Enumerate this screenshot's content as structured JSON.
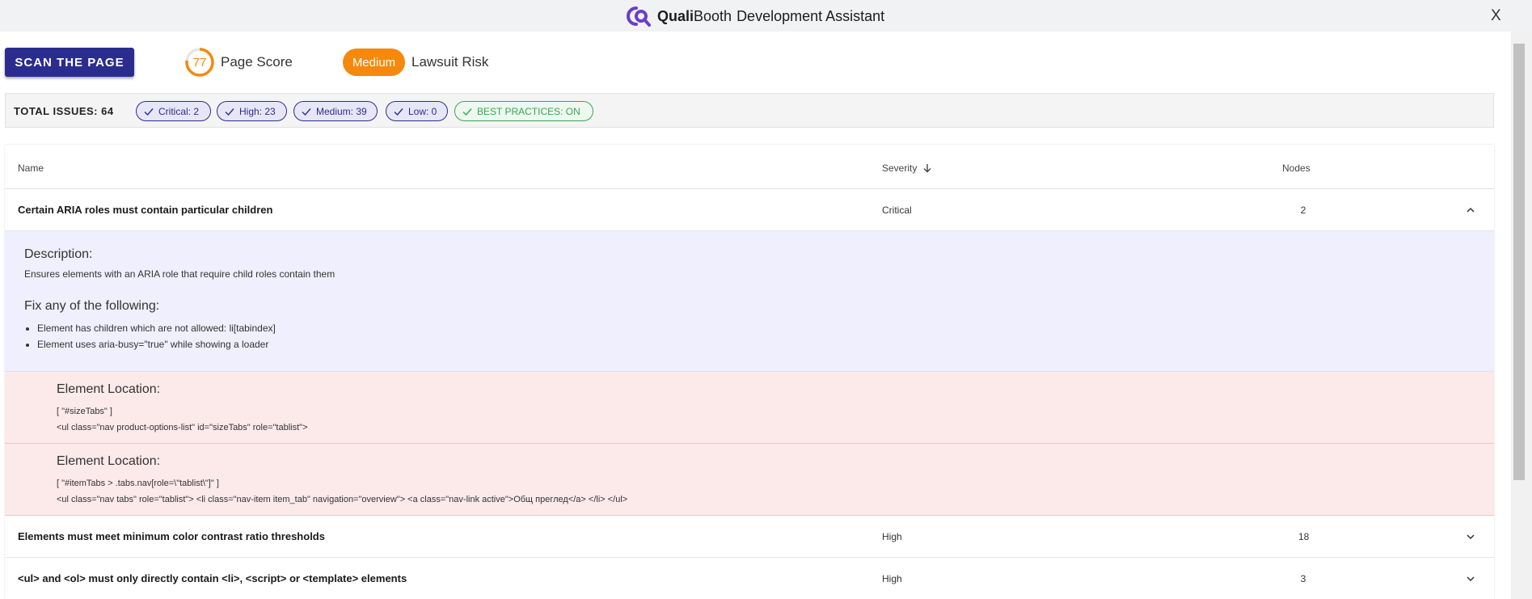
{
  "header": {
    "brand_bold": "Quali",
    "brand_regular": "Booth",
    "brand_suffix": "Development Assistant",
    "close_label": "X"
  },
  "toolbar": {
    "scan_label": "SCAN THE PAGE",
    "score_value": "77",
    "score_percent": 77,
    "score_label": "Page Score",
    "risk_value": "Medium",
    "risk_label": "Lawsuit Risk"
  },
  "issues": {
    "total_label": "TOTAL ISSUES: 64",
    "chips": [
      {
        "label": "Critical: 2"
      },
      {
        "label": "High: 23"
      },
      {
        "label": "Medium: 39"
      },
      {
        "label": "Low: 0"
      },
      {
        "label": "BEST PRACTICES: ON"
      }
    ]
  },
  "table": {
    "headers": {
      "name": "Name",
      "severity": "Severity",
      "nodes": "Nodes"
    },
    "rows": [
      {
        "name": "Certain ARIA roles must contain particular children",
        "severity": "Critical",
        "nodes": "2"
      },
      {
        "name": "Elements must meet minimum color contrast ratio thresholds",
        "severity": "High",
        "nodes": "18"
      },
      {
        "name": "<ul> and <ol> must only directly contain <li>, <script> or <template> elements",
        "severity": "High",
        "nodes": "3"
      }
    ],
    "expanded": {
      "description_title": "Description:",
      "description_text": "Ensures elements with an ARIA role that require child roles contain them",
      "fix_title": "Fix any of the following:",
      "fixes": [
        "Element has children which are not allowed: li[tabindex]",
        "Element uses aria-busy=\"true\" while showing a loader"
      ],
      "locations": [
        {
          "title": "Element Location:",
          "selector": "[ \"#sizeTabs\" ]",
          "html": "<ul class=\"nav product-options-list\" id=\"sizeTabs\" role=\"tablist\">"
        },
        {
          "title": "Element Location:",
          "selector": "[ \"#itemTabs > .tabs.nav[role=\\\"tablist\\\"]\" ]",
          "html": "<ul class=\"nav tabs\" role=\"tablist\"> <li class=\"nav-item item_tab\" navigation=\"overview\"> <a class=\"nav-link active\">Общ преглед</a> </li> </ul>"
        }
      ]
    }
  },
  "colors": {
    "primary": "#2b2d8e",
    "risk_medium": "#f5890d",
    "score_ring": "#f5890d",
    "best_practice": "#3aa655",
    "description_bg": "#efeffd",
    "location_bg": "#fce9ea"
  },
  "icons": {
    "logo": "qualibooth-logo-icon",
    "chip_check": "check-icon",
    "sort": "arrow-down-icon",
    "expand": "chevron-down-icon",
    "collapse": "chevron-up-icon"
  }
}
